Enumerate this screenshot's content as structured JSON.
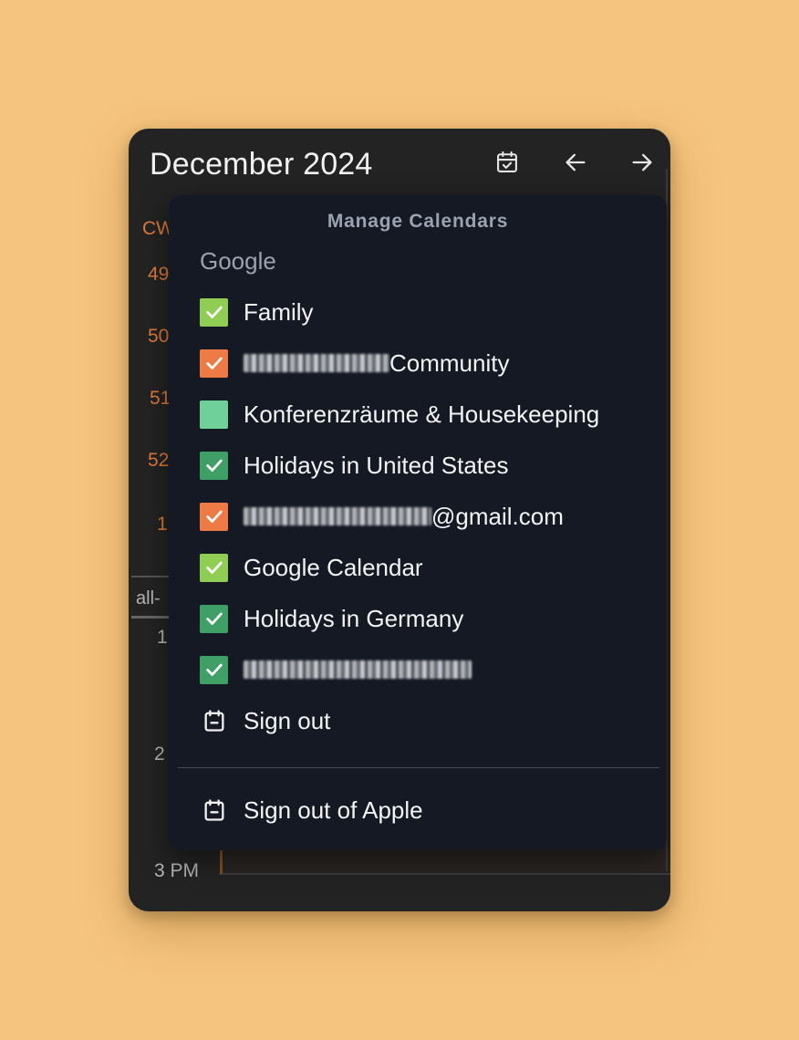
{
  "header": {
    "title": "December 2024",
    "today_icon": "calendar-check-icon",
    "prev_icon": "arrow-left-icon",
    "next_icon": "arrow-right-icon"
  },
  "background": {
    "cw_label": "CW",
    "weeks": [
      "49",
      "50",
      "51",
      "52",
      "1"
    ],
    "allday_label": "all-",
    "hours": [
      "1",
      "2",
      "3 PM"
    ]
  },
  "popover": {
    "title": "Manage Calendars",
    "section": "Google",
    "calendars": [
      {
        "label": "Family",
        "color": "#8fcd55",
        "checked": true,
        "blurred_prefix": false
      },
      {
        "label": "Community",
        "color": "#ee7a45",
        "checked": true,
        "blurred_prefix": true
      },
      {
        "label": "Konferenzräume & Housekeeping",
        "color": "#6fd09a",
        "checked": false,
        "blurred_prefix": false
      },
      {
        "label": "Holidays in United States",
        "color": "#3f9f66",
        "checked": true,
        "blurred_prefix": false
      },
      {
        "label": "@gmail.com",
        "color": "#ee7a45",
        "checked": true,
        "blurred_prefix": true
      },
      {
        "label": "Google Calendar",
        "color": "#8fcd55",
        "checked": true,
        "blurred_prefix": false
      },
      {
        "label": "Holidays in Germany",
        "color": "#3f9f66",
        "checked": true,
        "blurred_prefix": false
      },
      {
        "label": "",
        "color": "#3f9f66",
        "checked": true,
        "blurred_prefix": true
      }
    ],
    "sign_out": "Sign out",
    "sign_out_apple": "Sign out of Apple",
    "sign_out_icon": "calendar-minus-icon"
  }
}
